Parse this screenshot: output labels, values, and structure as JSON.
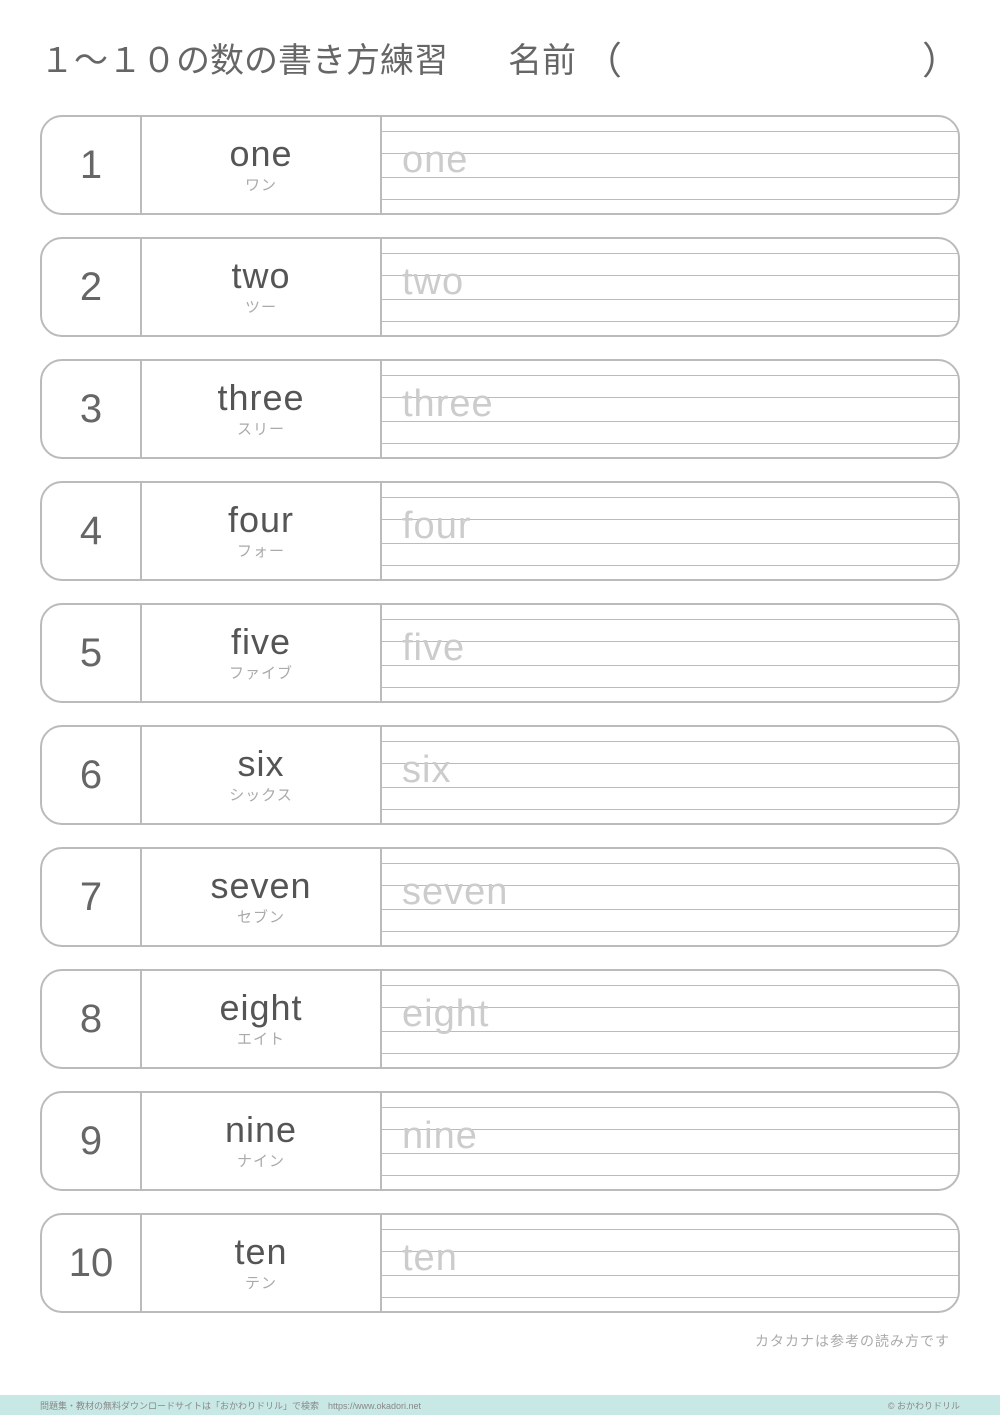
{
  "header": {
    "title": "１～１０の数の書き方練習",
    "nameLabel": "名前",
    "parenOpen": "（",
    "parenClose": "）"
  },
  "rows": [
    {
      "num": "1",
      "word": "one",
      "kana": "ワン",
      "trace": "one"
    },
    {
      "num": "2",
      "word": "two",
      "kana": "ツー",
      "trace": "two"
    },
    {
      "num": "3",
      "word": "three",
      "kana": "スリー",
      "trace": "three"
    },
    {
      "num": "4",
      "word": "four",
      "kana": "フォー",
      "trace": "four"
    },
    {
      "num": "5",
      "word": "five",
      "kana": "ファイブ",
      "trace": "five"
    },
    {
      "num": "6",
      "word": "six",
      "kana": "シックス",
      "trace": "six"
    },
    {
      "num": "7",
      "word": "seven",
      "kana": "セブン",
      "trace": "seven"
    },
    {
      "num": "8",
      "word": "eight",
      "kana": "エイト",
      "trace": "eight"
    },
    {
      "num": "9",
      "word": "nine",
      "kana": "ナイン",
      "trace": "nine"
    },
    {
      "num": "10",
      "word": "ten",
      "kana": "テン",
      "trace": "ten"
    }
  ],
  "footerNote": "カタカナは参考の読み方です",
  "bottom": {
    "left": "問題集・教材の無料ダウンロードサイトは「おかわりドリル」で検索　https://www.okadori.net",
    "right": "© おかわりドリル"
  }
}
